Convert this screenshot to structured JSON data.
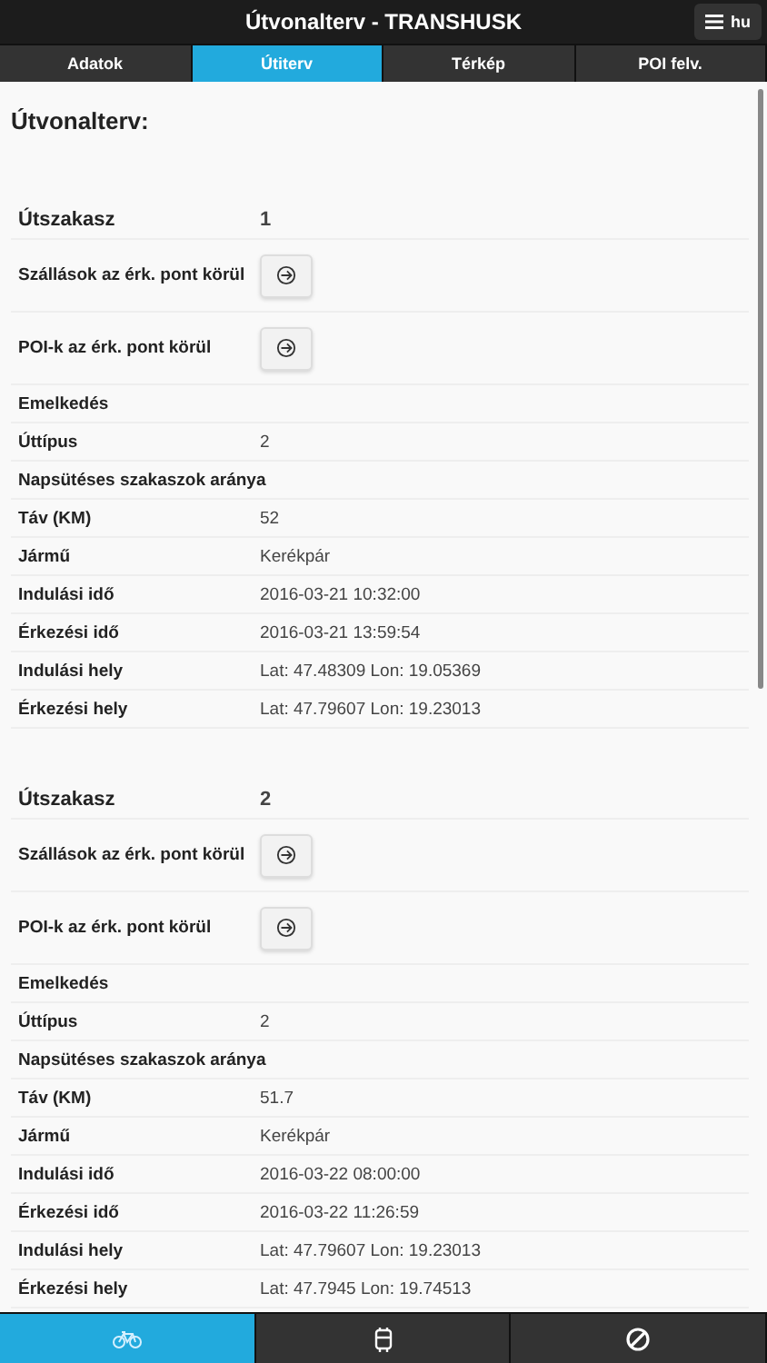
{
  "header": {
    "title": "Útvonalterv - TRANSHUSK",
    "menu_label": "hu"
  },
  "tabs": [
    {
      "label": "Adatok",
      "selected": false
    },
    {
      "label": "Útiterv",
      "selected": true
    },
    {
      "label": "Térkép",
      "selected": false
    },
    {
      "label": "POI felv.",
      "selected": false
    }
  ],
  "page_title": "Útvonalterv:",
  "sections": [
    {
      "title": "Útszakasz",
      "number": "1",
      "rows": [
        {
          "kind": "button",
          "label": "Szállások az érk. pont körül"
        },
        {
          "kind": "button",
          "label": "POI-k az érk. pont körül"
        },
        {
          "kind": "text",
          "label": "Emelkedés"
        },
        {
          "kind": "text",
          "label": "Úttípus",
          "value": "2"
        },
        {
          "kind": "text",
          "label": "Napsütéses szakaszok aránya"
        },
        {
          "kind": "text",
          "label": "Táv (KM)",
          "value": "52"
        },
        {
          "kind": "text",
          "label": "Jármű",
          "value": "Kerékpár"
        },
        {
          "kind": "text",
          "label": "Indulási idő",
          "value": "2016-03-21 10:32:00"
        },
        {
          "kind": "text",
          "label": "Érkezési idő",
          "value": "2016-03-21 13:59:54"
        },
        {
          "kind": "text",
          "label": "Indulási hely",
          "value": "Lat: 47.48309 Lon: 19.05369"
        },
        {
          "kind": "text",
          "label": "Érkezési hely",
          "value": "Lat: 47.79607 Lon: 19.23013"
        }
      ]
    },
    {
      "title": "Útszakasz",
      "number": "2",
      "rows": [
        {
          "kind": "button",
          "label": "Szállások az érk. pont körül"
        },
        {
          "kind": "button",
          "label": "POI-k az érk. pont körül"
        },
        {
          "kind": "text",
          "label": "Emelkedés"
        },
        {
          "kind": "text",
          "label": "Úttípus",
          "value": "2"
        },
        {
          "kind": "text",
          "label": "Napsütéses szakaszok aránya"
        },
        {
          "kind": "text",
          "label": "Táv (KM)",
          "value": "51.7"
        },
        {
          "kind": "text",
          "label": "Jármű",
          "value": "Kerékpár"
        },
        {
          "kind": "text",
          "label": "Indulási idő",
          "value": "2016-03-22 08:00:00"
        },
        {
          "kind": "text",
          "label": "Érkezési idő",
          "value": "2016-03-22 11:26:59"
        },
        {
          "kind": "text",
          "label": "Indulási hely",
          "value": "Lat: 47.79607 Lon: 19.23013"
        },
        {
          "kind": "text",
          "label": "Érkezési hely",
          "value": "Lat: 47.7945 Lon: 19.74513"
        }
      ]
    }
  ],
  "bottom_nav": [
    {
      "kind": "bicycle",
      "selected": true
    },
    {
      "kind": "bus",
      "selected": false
    },
    {
      "kind": "prohibited",
      "selected": false
    }
  ]
}
